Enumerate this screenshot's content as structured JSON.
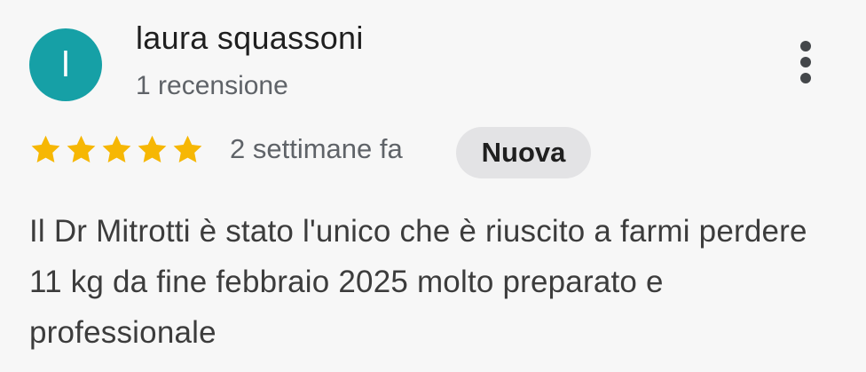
{
  "reviewer": {
    "avatar_initial": "l",
    "avatar_color": "#16a0a6",
    "name": "laura squassoni",
    "review_count": "1 recensione"
  },
  "rating": {
    "stars": 5,
    "max_stars": 5,
    "star_color": "#f6b704",
    "time_ago": "2 settimane fa",
    "badge": "Nuova"
  },
  "review": {
    "text": "Il Dr Mitrotti è stato l'unico che è riuscito a farmi perdere 11 kg da fine febbraio 2025 molto preparato e professionale"
  },
  "menu_icon": "more-vert-icon"
}
